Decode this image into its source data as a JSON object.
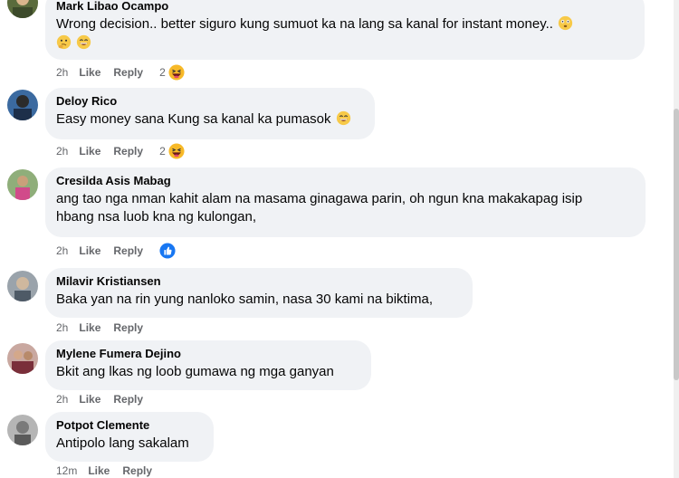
{
  "comments": [
    {
      "author": "Mark Libao Ocampo",
      "text": "Wrong decision.. better siguro kung sumuot ka na lang sa kanal for instant money..",
      "time": "2h",
      "like": "Like",
      "reply": "Reply",
      "reaction_count": "2",
      "reaction_icon": "haha-icon"
    },
    {
      "author": "Deloy Rico",
      "text": "Easy money sana Kung sa kanal ka pumasok",
      "time": "2h",
      "like": "Like",
      "reply": "Reply",
      "reaction_count": "2",
      "reaction_icon": "haha-icon"
    },
    {
      "author": "Cresilda Asis Mabag",
      "text_line1": "ang tao nga nman kahit alam na masama ginagawa parin, oh ngun kna makakapag isip",
      "text_line2": "hbang nsa luob kna ng kulongan,",
      "time": "2h",
      "like": "Like",
      "reply": "Reply",
      "reaction_icon": "like-icon"
    },
    {
      "author": "Milavir Kristiansen",
      "text": "Baka yan na rin yung nanloko samin, nasa 30 kami na biktima,",
      "time": "2h",
      "like": "Like",
      "reply": "Reply"
    },
    {
      "author": "Mylene Fumera Dejino",
      "text": "Bkit ang lkas ng loob gumawa ng mga ganyan",
      "time": "2h",
      "like": "Like",
      "reply": "Reply"
    },
    {
      "author": "Potpot Clemente",
      "text": "Antipolo lang sakalam",
      "time": "12m",
      "like": "Like",
      "reply": "Reply"
    }
  ],
  "colors": {
    "bubble": "#f0f2f5",
    "meta": "#65676b",
    "like_blue": "#1877f2",
    "haha_yellow": "#f7b928"
  }
}
